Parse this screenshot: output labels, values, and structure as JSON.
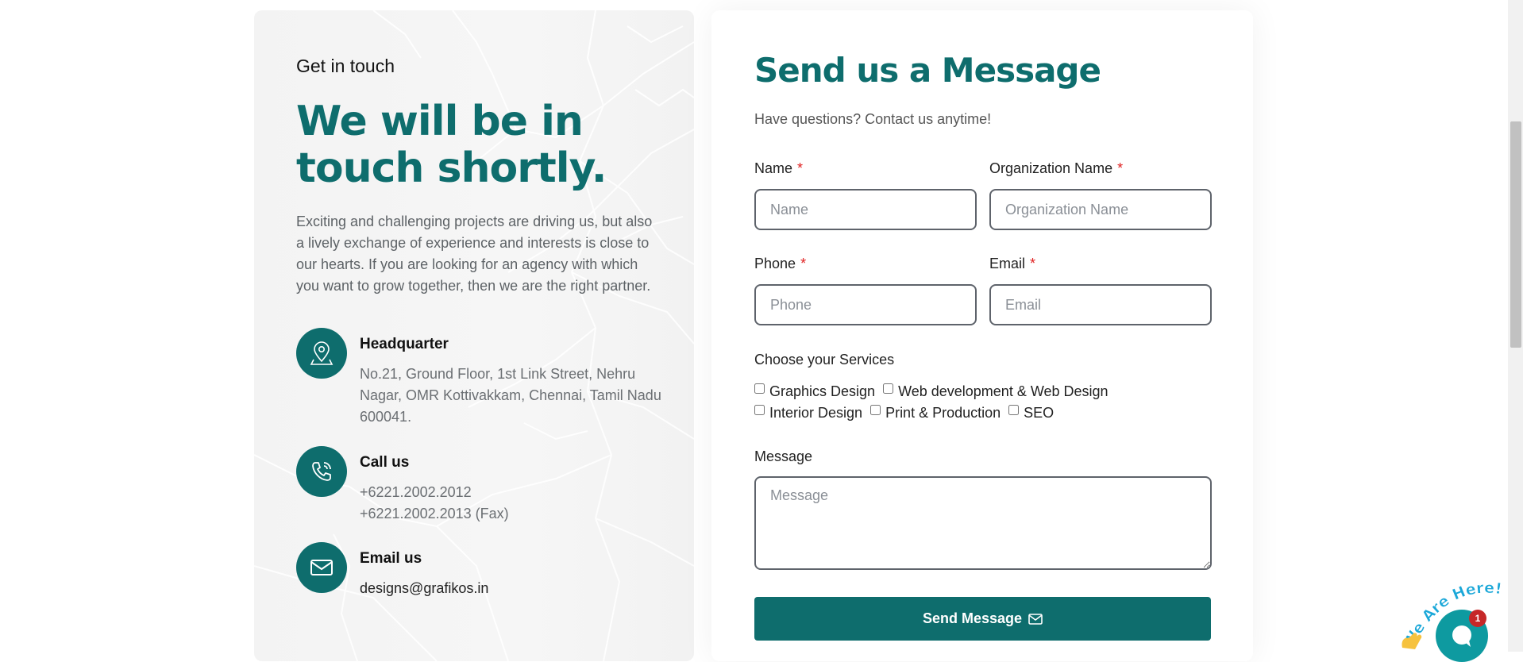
{
  "contact_info": {
    "eyebrow": "Get in touch",
    "headline": "We will be in touch shortly.",
    "intro": "Exciting and challenging projects are driving us, but also a lively exchange of experience and interests is close to our hearts. If you are looking for an agency with which you want to grow together, then we are the right partner.",
    "items": [
      {
        "icon": "location-pin-icon",
        "title": "Headquarter",
        "lines": [
          "No.21, Ground Floor, 1st Link Street, Nehru Nagar, OMR Kottivakkam, Chennai, Tamil Nadu 600041."
        ]
      },
      {
        "icon": "phone-icon",
        "title": "Call us",
        "lines": [
          "+6221.2002.2012",
          "+6221.2002.2013 (Fax)"
        ]
      },
      {
        "icon": "mail-icon",
        "title": "Email us",
        "lines": [
          "designs@grafikos.in"
        ]
      }
    ]
  },
  "form": {
    "title": "Send us a Message",
    "subtitle": "Have questions? Contact us anytime!",
    "required_marker": "*",
    "fields": {
      "name": {
        "label": "Name",
        "placeholder": "Name",
        "value": ""
      },
      "organization": {
        "label": "Organization Name",
        "placeholder": "Organization Name",
        "value": ""
      },
      "phone": {
        "label": "Phone",
        "placeholder": "Phone",
        "value": ""
      },
      "email": {
        "label": "Email",
        "placeholder": "Email",
        "value": ""
      },
      "message": {
        "label": "Message",
        "placeholder": "Message",
        "value": ""
      }
    },
    "services_label": "Choose your Services",
    "services": [
      {
        "label": "Graphics Design",
        "checked": false
      },
      {
        "label": "Web development & Web Design",
        "checked": false
      },
      {
        "label": "Interior Design",
        "checked": false
      },
      {
        "label": "Print & Production",
        "checked": false
      },
      {
        "label": "SEO",
        "checked": false
      }
    ],
    "submit_label": "Send Message",
    "submit_icon": "envelope-icon"
  },
  "chat_widget": {
    "label": "We Are Here!",
    "badge_count": "1"
  },
  "colors": {
    "brand_teal": "#0e6d6d",
    "required_red": "#e02020",
    "chat_teal": "#0e9aa0",
    "badge_red": "#c62828"
  }
}
